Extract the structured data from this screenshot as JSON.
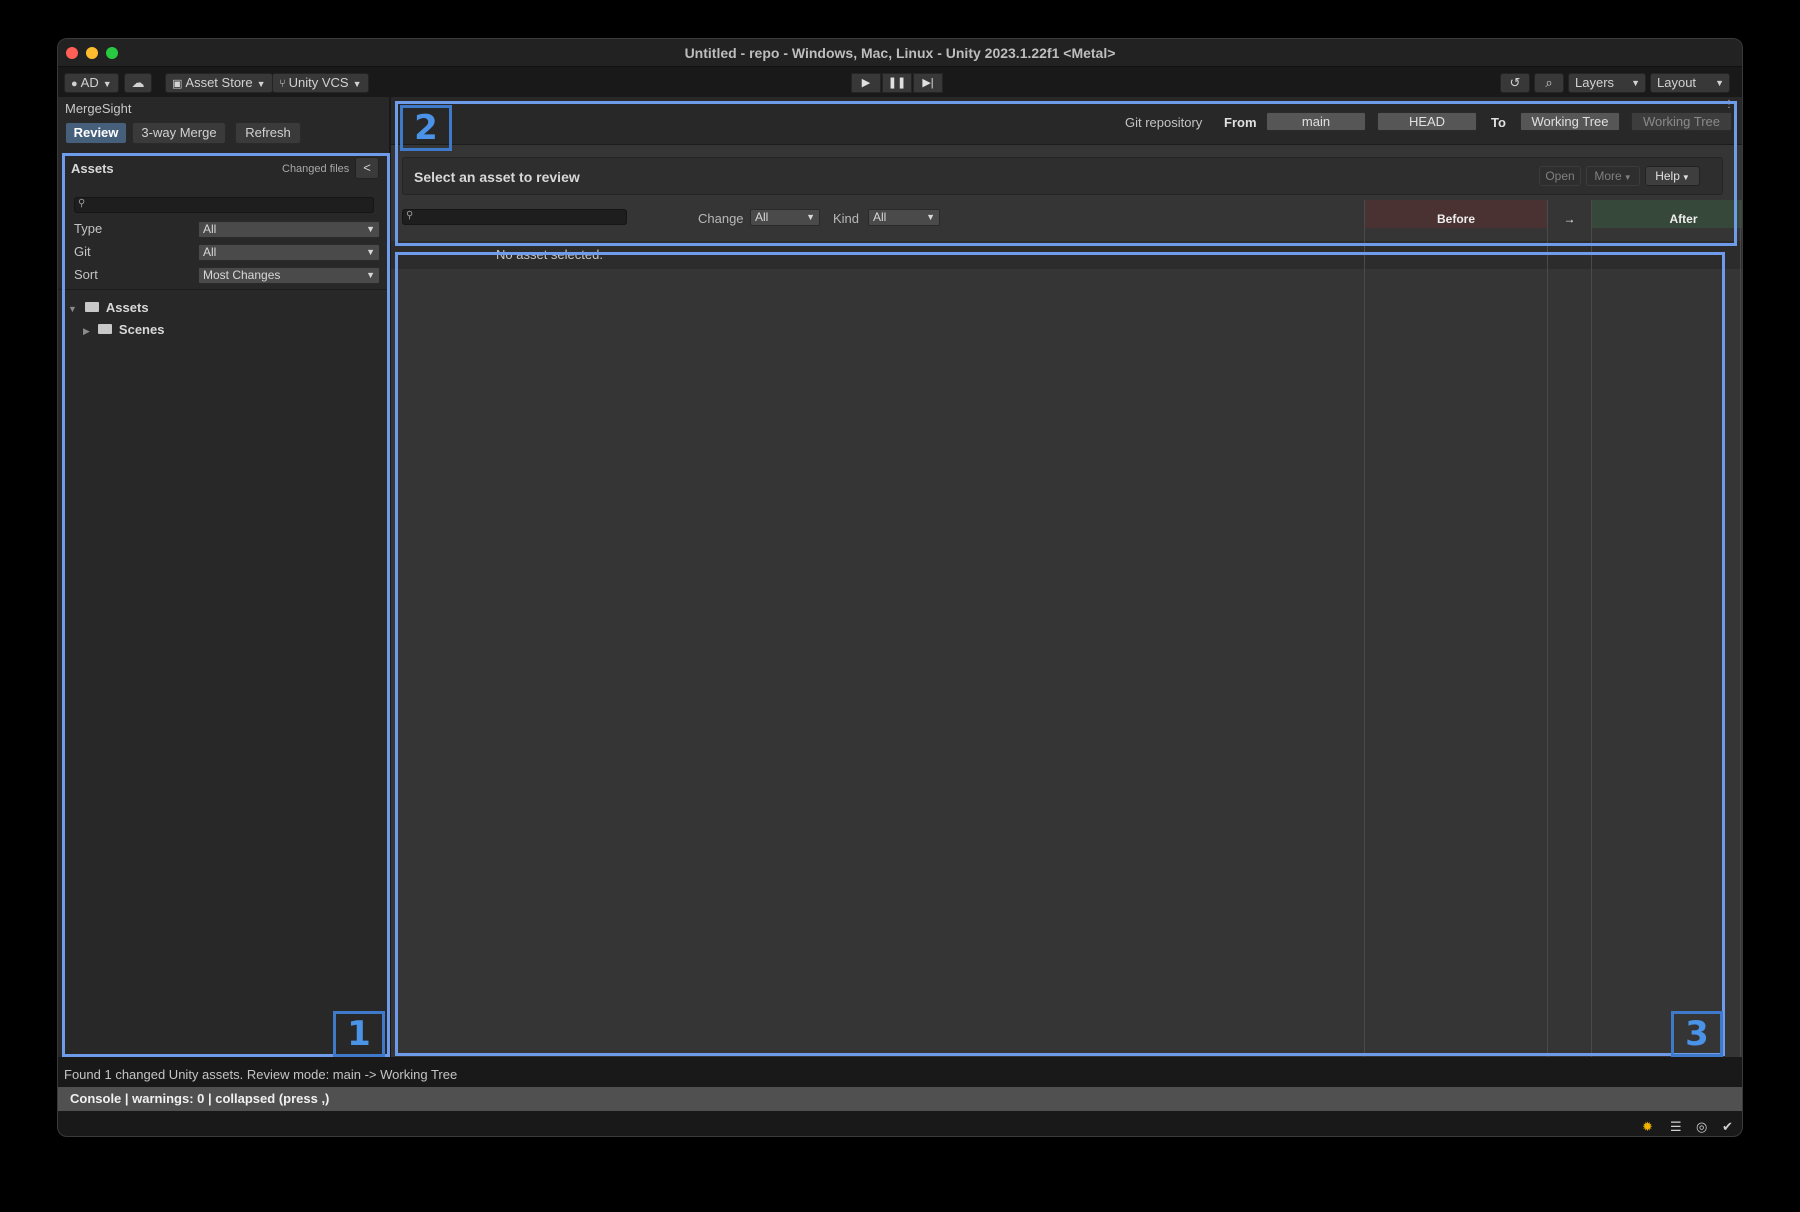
{
  "window": {
    "title": "Untitled - repo - Windows, Mac, Linux - Unity 2023.1.22f1 <Metal>"
  },
  "toolbar": {
    "account": "AD",
    "asset_store": "Asset Store",
    "vcs": "Unity VCS",
    "layers": "Layers",
    "layout": "Layout"
  },
  "panel": {
    "title": "MergeSight",
    "modes": [
      "Review",
      "3-way Merge",
      "Refresh"
    ],
    "active_mode": "Review"
  },
  "assets": {
    "header": "Assets",
    "changed_files": "Changed files",
    "collapse": "<",
    "search_placeholder": "",
    "filters": [
      {
        "label": "Type",
        "value": "All"
      },
      {
        "label": "Git",
        "value": "All"
      },
      {
        "label": "Sort",
        "value": "Most Changes"
      }
    ],
    "tree": [
      {
        "label": "Assets",
        "expanded": true
      },
      {
        "label": "Scenes",
        "expanded": false
      }
    ]
  },
  "compare": {
    "git_label": "Git repository",
    "from_label": "From",
    "from_branch": "main",
    "from_ref": "HEAD",
    "to_label": "To",
    "to_target": "Working Tree",
    "to_target_2": "Working Tree"
  },
  "review": {
    "title": "Select an asset to review",
    "open": "Open",
    "more": "More",
    "help": "Help",
    "change_label": "Change",
    "change_value": "All",
    "kind_label": "Kind",
    "kind_value": "All",
    "col_before": "Before",
    "col_arrow": "→",
    "col_after": "After",
    "empty_message": "No asset selected."
  },
  "status": {
    "line": "Found 1 changed Unity assets. Review mode: main -> Working Tree",
    "console": "Console | warnings: 0 | collapsed (press ,)"
  },
  "annotations": [
    "1",
    "2",
    "3"
  ],
  "colors": {
    "accent_tab": "#46607c",
    "before_header": "#4a3232",
    "after_header": "#36483a",
    "highlight": "#6e9bea"
  }
}
